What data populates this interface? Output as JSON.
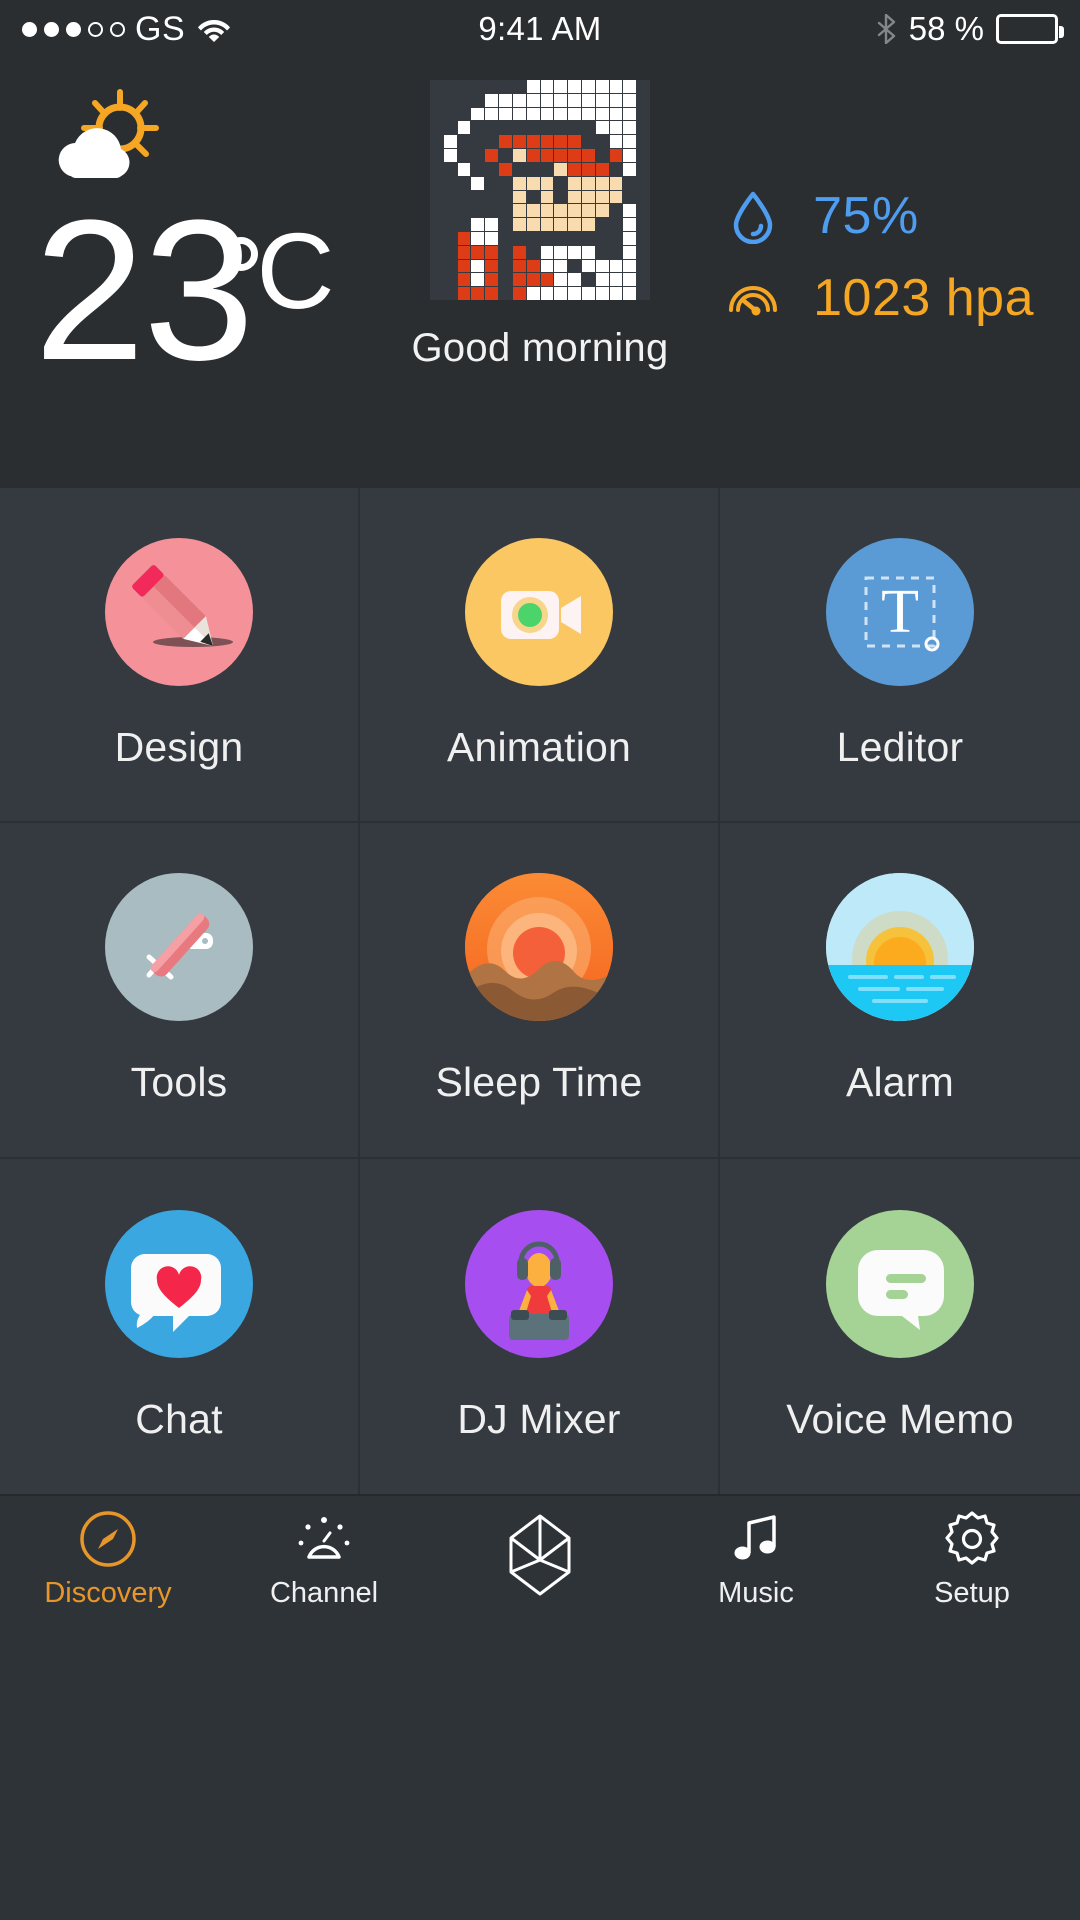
{
  "status_bar": {
    "signal_dots_filled": 3,
    "signal_dots_total": 5,
    "carrier": "GS",
    "wifi_icon": "wifi-icon",
    "time": "9:41 AM",
    "bluetooth_icon": "bluetooth-icon",
    "battery_percent": "58 %",
    "battery_level": 58
  },
  "weather": {
    "condition_icon": "sun-behind-cloud-icon",
    "temperature": "23",
    "unit": "C",
    "greeting": "Good morning",
    "avatar_icon": "pixel-art-avatar",
    "stats": [
      {
        "icon": "water-drop-icon",
        "value": "75%",
        "color": "#4f9df0",
        "name": "humidity"
      },
      {
        "icon": "pressure-gauge-icon",
        "value": "1023 hpa",
        "color": "#f5a623",
        "name": "pressure"
      }
    ]
  },
  "apps": [
    {
      "label": "Design",
      "icon": "pencil-icon",
      "color": "#f49199"
    },
    {
      "label": "Animation",
      "icon": "video-camera-icon",
      "color": "#fac762"
    },
    {
      "label": "Leditor",
      "icon": "text-tool-icon",
      "color": "#5b9bd5"
    },
    {
      "label": "Tools",
      "icon": "swiss-knife-icon",
      "color": "#a9bcc1"
    },
    {
      "label": "Sleep Time",
      "icon": "sunset-dunes-icon",
      "color": "#f4742a"
    },
    {
      "label": "Alarm",
      "icon": "sunrise-sea-icon",
      "color": "#2ecdfb"
    },
    {
      "label": "Chat",
      "icon": "heart-bubble-icon",
      "color": "#3ba7e0"
    },
    {
      "label": "DJ Mixer",
      "icon": "dj-person-icon",
      "color": "#a64ef0"
    },
    {
      "label": "Voice Memo",
      "icon": "message-bubble-icon",
      "color": "#a5d396"
    }
  ],
  "tabs": [
    {
      "label": "Discovery",
      "icon": "compass-icon",
      "active": true
    },
    {
      "label": "Channel",
      "icon": "radar-icon",
      "active": false
    },
    {
      "label": "",
      "icon": "cube-icon",
      "active": false
    },
    {
      "label": "Music",
      "icon": "music-note-icon",
      "active": false
    },
    {
      "label": "Setup",
      "icon": "gear-icon",
      "active": false
    }
  ],
  "theme": {
    "panel_bg": "#2a2e31",
    "grid_bg": "#343a40",
    "accent": "#e8962a"
  }
}
